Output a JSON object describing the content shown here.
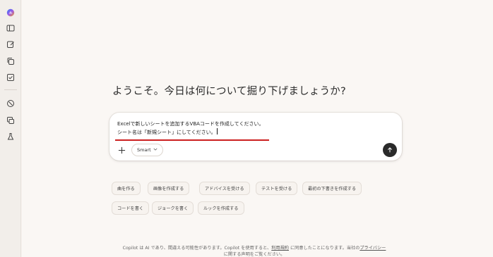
{
  "sidebar": {
    "icons": [
      {
        "name": "copilot-logo-icon"
      },
      {
        "name": "sidebar-toggle-icon"
      },
      {
        "name": "new-chat-icon"
      },
      {
        "name": "copy-icon"
      },
      {
        "name": "tasks-icon"
      },
      {
        "name": "discover-icon"
      },
      {
        "name": "image-gallery-icon"
      },
      {
        "name": "labs-flask-icon"
      }
    ]
  },
  "main": {
    "greeting": "ようこそ。今日は何について掘り下げましょうか?"
  },
  "composer": {
    "line1": "Excelで新しいシートを追加するVBAコードを作成してください。",
    "line2": "シート名は「新規シート」にしてください。",
    "model_label": "Smart",
    "accent_underline_color": "#cc1f1f"
  },
  "suggestions": [
    "曲を作る",
    "画像を作成する",
    "アドバイスを受ける",
    "テストを受ける",
    "最初の下書きを作成する",
    "コードを書く",
    "ジョークを書く",
    "ルックを作成する"
  ],
  "footer": {
    "text_before_terms": "Copilot は AI であり、間違える可能性があります。Copilot を使用すると、",
    "terms_link": "利用規約",
    "text_between": " に同意したことになります。当社の",
    "privacy_link": "プライバシー",
    "line2": "に関する声明をご覧ください。"
  }
}
